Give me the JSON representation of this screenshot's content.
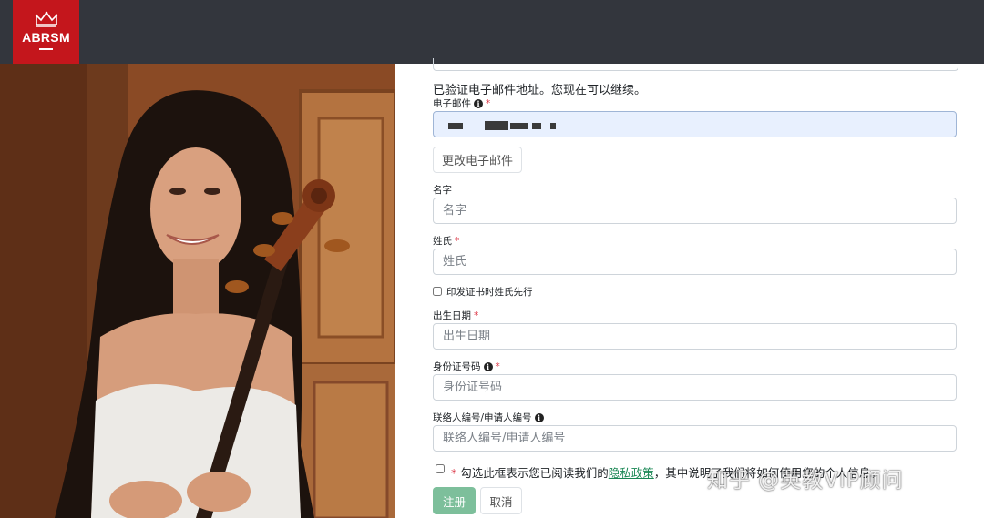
{
  "header": {
    "brand": "ABRSM"
  },
  "form": {
    "verified_message": "已验证电子邮件地址。您现在可以继续。",
    "email": {
      "label": "电子邮件",
      "required_mark": "*"
    },
    "change_email_button": "更改电子邮件",
    "first_name": {
      "label": "名字",
      "placeholder": "名字"
    },
    "last_name": {
      "label": "姓氏",
      "required_mark": "*",
      "placeholder": "姓氏"
    },
    "surname_first_checkbox": {
      "label": "印发证书时姓氏先行",
      "checked": false
    },
    "dob": {
      "label": "出生日期",
      "required_mark": "*",
      "placeholder": "出生日期"
    },
    "id_number": {
      "label": "身份证号码",
      "required_mark": "*",
      "placeholder": "身份证号码"
    },
    "contact_number": {
      "label": "联络人编号/申请人编号",
      "placeholder": "联络人编号/申请人编号"
    },
    "consent": {
      "required_mark": "*",
      "text_before": "勾选此框表示您已阅读我们的",
      "link_text": "隐私政策",
      "text_after": "，其中说明了我们将如何使用您的个人信息。",
      "checked": false
    },
    "register_button": "注册",
    "cancel_button": "取消"
  },
  "watermark": "知乎 @英教VIP顾问",
  "colors": {
    "header_bg": "#33363d",
    "brand_red": "#c4161c",
    "primary_green": "#7dbf9b",
    "link_green": "#198754",
    "required_red": "#dc3545"
  },
  "icons": [
    "crown-icon",
    "info-icon"
  ]
}
